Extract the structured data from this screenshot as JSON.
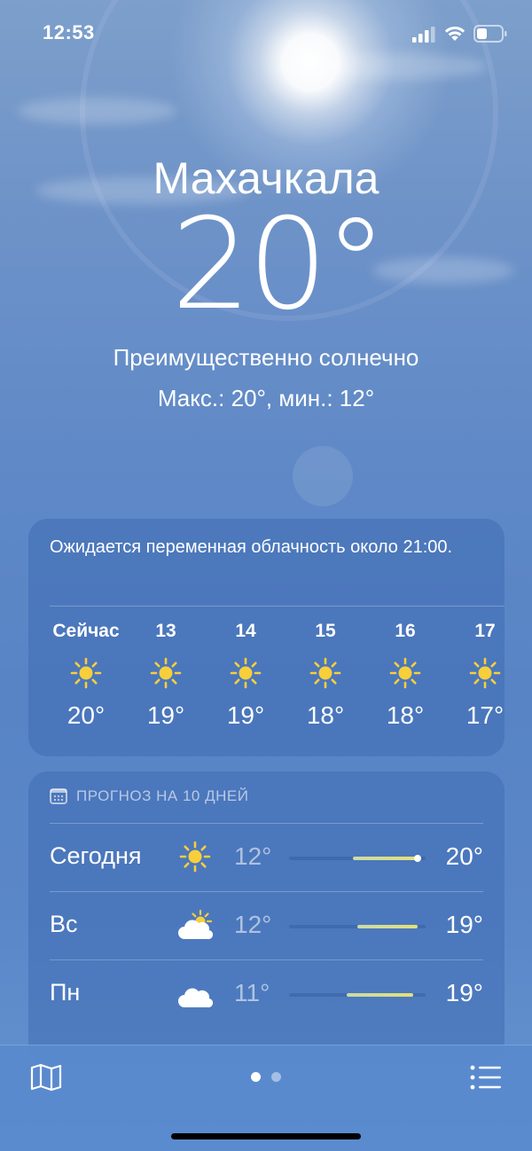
{
  "status_bar": {
    "time": "12:53"
  },
  "header": {
    "city": "Махачкала",
    "temperature": "20°",
    "condition": "Преимущественно солнечно",
    "hilo": "Макс.: 20°, мин.: 12°"
  },
  "hourly": {
    "summary": "Ожидается переменная облачность около 21:00.",
    "items": [
      {
        "time": "Сейчас",
        "icon": "sun-icon",
        "temp": "20°"
      },
      {
        "time": "13",
        "icon": "sun-icon",
        "temp": "19°"
      },
      {
        "time": "14",
        "icon": "sun-icon",
        "temp": "19°"
      },
      {
        "time": "15",
        "icon": "sun-icon",
        "temp": "18°"
      },
      {
        "time": "16",
        "icon": "sun-icon",
        "temp": "18°"
      },
      {
        "time": "17",
        "icon": "sun-icon",
        "temp": "17°"
      }
    ]
  },
  "forecast": {
    "title": "ПРОГНОЗ НА 10 ДНЕЙ",
    "days": [
      {
        "day": "Сегодня",
        "icon": "sun-icon",
        "low": "12°",
        "high": "20°",
        "range_start": 0.47,
        "range_end": 0.93,
        "current_marker": 0.94
      },
      {
        "day": "Вс",
        "icon": "partly-cloudy-icon",
        "low": "12°",
        "high": "19°",
        "range_start": 0.5,
        "range_end": 0.94
      },
      {
        "day": "Пн",
        "icon": "cloud-icon",
        "low": "11°",
        "high": "19°",
        "range_start": 0.42,
        "range_end": 0.91
      }
    ]
  },
  "bottom_bar": {
    "pages": 2,
    "active_page": 0
  },
  "colors": {
    "sun": "#f7cf3a",
    "range_fill_start": "#c9dca6",
    "range_fill_end": "#e4e078"
  }
}
